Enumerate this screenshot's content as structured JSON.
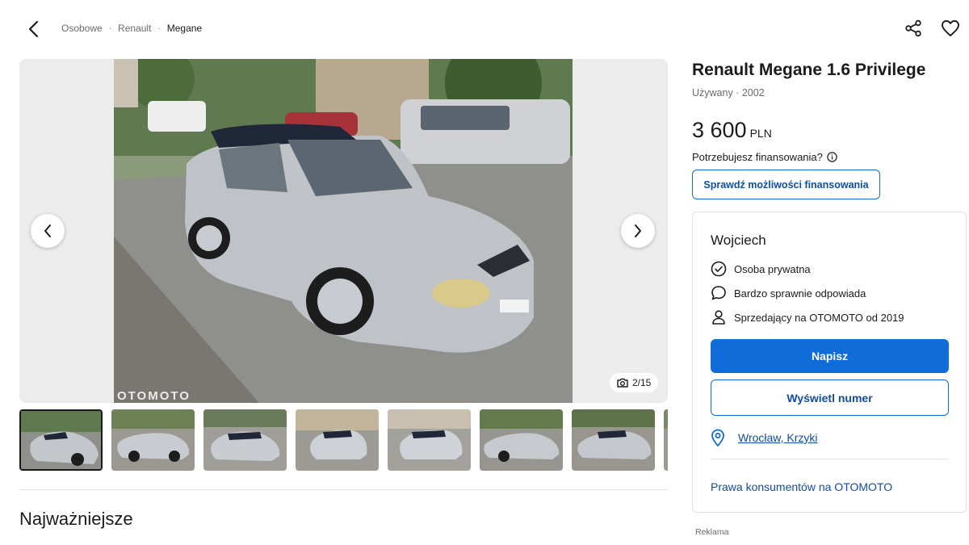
{
  "breadcrumb": {
    "items": [
      "Osobowe",
      "Renault",
      "Megane"
    ],
    "separator": "·"
  },
  "icons": {
    "back": "chevron-left-icon",
    "share": "share-icon",
    "favorite": "heart-icon",
    "prev": "chevron-left-icon",
    "next": "chevron-right-icon",
    "camera": "camera-icon",
    "check": "check-circle-icon",
    "chat": "chat-bubble-icon",
    "person": "person-icon",
    "location": "map-pin-icon",
    "info": "info-icon"
  },
  "gallery": {
    "counter": "2/15",
    "watermark": "OTOMOTO",
    "thumbnail_count": 8
  },
  "listing": {
    "title": "Renault Megane 1.6 Privilege",
    "subtitle": "Używany · 2002",
    "price_amount": "3 600",
    "price_currency": "PLN",
    "finance_question": "Potrzebujesz finansowania?",
    "finance_button": "Sprawdź możliwości finansowania"
  },
  "seller": {
    "name": "Wojciech",
    "features": [
      "Osoba prywatna",
      "Bardzo sprawnie odpowiada",
      "Sprzedający na OTOMOTO od 2019"
    ],
    "write_button": "Napisz",
    "show_number_button": "Wyświetl numer",
    "location": "Wrocław, Krzyki",
    "consumer_rights_link": "Prawa konsumentów na OTOMOTO"
  },
  "main": {
    "section_title": "Najważniejsze"
  },
  "ad_label": "Reklama",
  "colors": {
    "accent": "#0f6cd9",
    "link": "#0f4da8",
    "text": "#1b1b1b",
    "muted": "#6b6b6b"
  }
}
